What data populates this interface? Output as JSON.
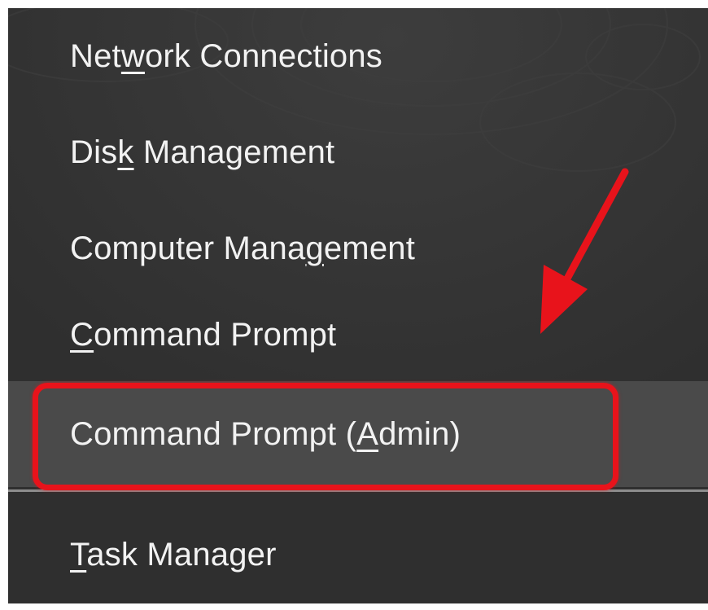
{
  "menu": {
    "items": [
      {
        "pre": "Net",
        "key": "w",
        "post": "ork Connections"
      },
      {
        "pre": "Dis",
        "key": "k",
        "post": " Management"
      },
      {
        "pre": "Computer Mana",
        "key": "g",
        "post": "ement"
      },
      {
        "pre": "",
        "key": "C",
        "post": "ommand Prompt"
      },
      {
        "pre": "Command Prompt (",
        "key": "A",
        "post": "dmin)"
      },
      {
        "pre": "",
        "key": "T",
        "post": "ask Manager"
      }
    ]
  },
  "colors": {
    "menu_background": "#343434",
    "highlight_background": "#4a4a4a",
    "text": "#f2f2f2",
    "annotation_red": "#e8131b"
  },
  "icons": {
    "annotation_arrow": "red-arrow-icon"
  }
}
